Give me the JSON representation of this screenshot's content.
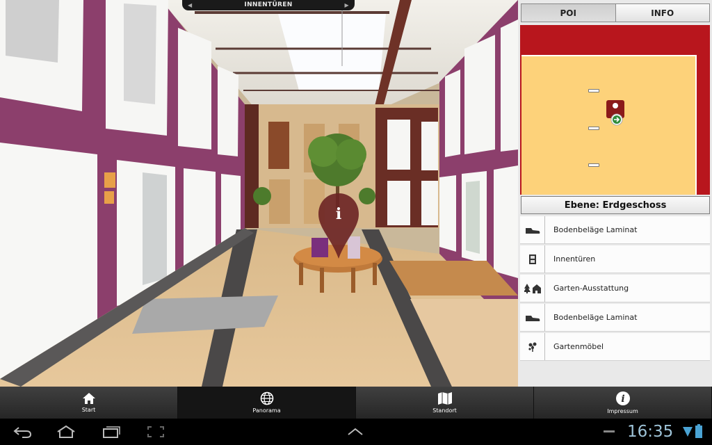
{
  "panorama": {
    "title": "INNENTÜREN",
    "info_glyph": "i"
  },
  "side": {
    "tabs": [
      {
        "label": "POI",
        "active": true
      },
      {
        "label": "INFO",
        "active": false
      }
    ],
    "level_label": "Ebene: Erdgeschoss",
    "poi_items": [
      {
        "label": "Bodenbeläge Laminat",
        "icon": "shoe-icon"
      },
      {
        "label": "Innentüren",
        "icon": "door-icon"
      },
      {
        "label": "Garten-Ausstattung",
        "icon": "trees-house-icon"
      },
      {
        "label": "Bodenbeläge Laminat",
        "icon": "shoe-icon"
      },
      {
        "label": "Gartenmöbel",
        "icon": "plant-icon"
      }
    ]
  },
  "nav": {
    "items": [
      {
        "label": "Start",
        "icon": "home-icon"
      },
      {
        "label": "Panorama",
        "icon": "globe-icon",
        "active": true
      },
      {
        "label": "Standort",
        "icon": "map-icon"
      },
      {
        "label": "Impressum",
        "icon": "info-icon"
      }
    ]
  },
  "system": {
    "clock": "16:35"
  },
  "colors": {
    "map_wall": "#b8161d",
    "map_floor": "#fdd27a",
    "marker": "#8b1a1a",
    "clock": "#9ec3d8"
  }
}
